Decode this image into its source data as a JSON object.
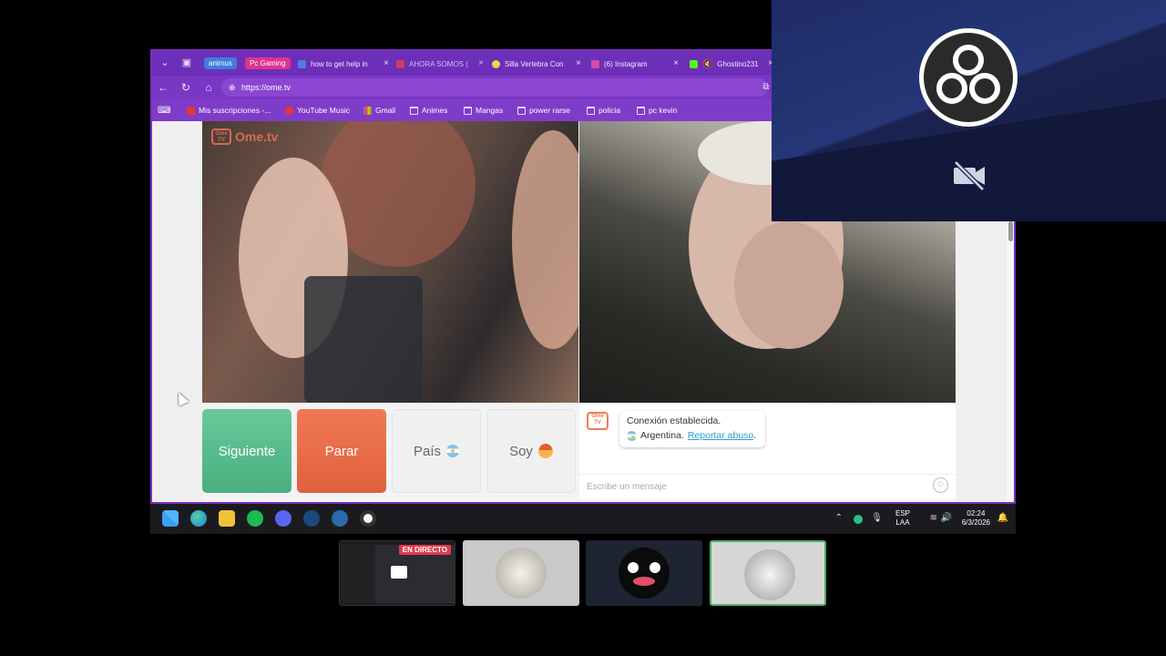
{
  "browser": {
    "tab_groups": [
      "animus",
      "Pc Gaming"
    ],
    "tabs": [
      {
        "title": "how to get help in",
        "favicon_color": "#4f7be8"
      },
      {
        "title": "AHORA SOMOS (",
        "favicon_color": "#e8453c"
      },
      {
        "title": "Silla Vertebra Con",
        "favicon_color": "#f2d24b"
      },
      {
        "title": "(6) Instagram",
        "favicon_color": "#d64aa3"
      },
      {
        "title": "Ghostino231",
        "favicon_color": "#53fc18"
      }
    ],
    "url": "https://ome.tv",
    "bookmarks": [
      {
        "label": "Mis suscripciones -...",
        "icon": "youtube-icon"
      },
      {
        "label": "YouTube Music",
        "icon": "youtube-music-icon"
      },
      {
        "label": "Gmail",
        "icon": "gmail-icon"
      },
      {
        "label": "Animes",
        "icon": "folder-icon"
      },
      {
        "label": "Mangas",
        "icon": "folder-icon"
      },
      {
        "label": "power rarse",
        "icon": "folder-icon"
      },
      {
        "label": "policia",
        "icon": "folder-icon"
      },
      {
        "label": "pc kevin",
        "icon": "folder-icon"
      }
    ]
  },
  "ometv": {
    "logo_badge": "Ome TV",
    "logo_text": "Ome.tv",
    "buttons": {
      "next": "Siguiente",
      "stop": "Parar",
      "country": "País",
      "gender": "Soy"
    },
    "chat": {
      "logo": "Ome TV",
      "status": "Conexión establecida.",
      "country": "Argentina.",
      "report": "Reportar abuso",
      "report_suffix": ".",
      "placeholder": "Escribe un mensaje"
    },
    "colors": {
      "next": "#5bbf8e",
      "stop": "#ea6b47",
      "link": "#2a9fd6"
    }
  },
  "taskbar": {
    "lang_top": "ESP",
    "lang_bottom": "LAA",
    "time": "02:24",
    "date": "6/3/2026"
  },
  "stream": {
    "live_badge": "EN DIRECTO"
  }
}
